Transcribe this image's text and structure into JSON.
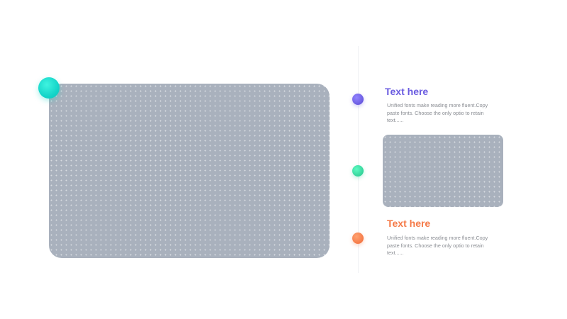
{
  "colors": {
    "accent_teal": "#12d3c7",
    "accent_purple": "#6a5be0",
    "accent_green": "#35d39a",
    "accent_orange": "#f57a48",
    "image_placeholder": "#a9b1bd"
  },
  "timeline": {
    "nodes": [
      {
        "color": "#6a5be0"
      },
      {
        "color": "#35d39a"
      },
      {
        "color": "#f57a48"
      }
    ],
    "items": [
      {
        "title": "Text here",
        "title_color": "#6a5be0",
        "body": "Unified fonts make reading more fluent.Copy paste fonts. Choose the only optio to retain text......"
      },
      {
        "title": "Text here",
        "title_color": "#f57a48",
        "body": "Unified fonts make reading more fluent.Copy paste fonts. Choose the only optio to retain text......"
      }
    ]
  }
}
